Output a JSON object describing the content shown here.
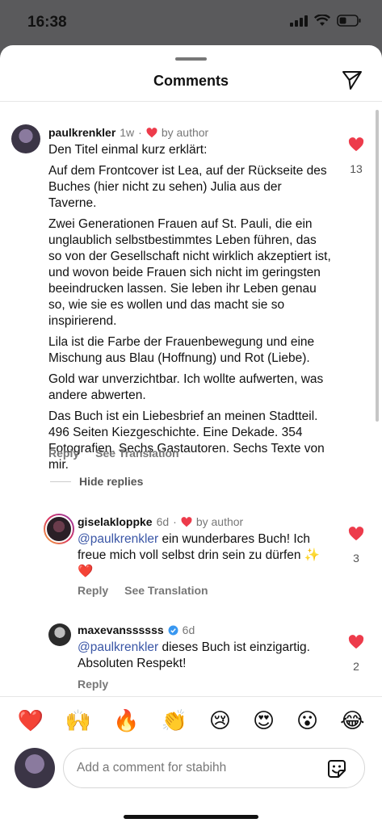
{
  "status_bar": {
    "time": "16:38",
    "icons": [
      "signal-icon",
      "wifi-icon",
      "battery-icon"
    ]
  },
  "header": {
    "title": "Comments",
    "share_icon": "send-icon"
  },
  "comments": [
    {
      "username": "paulkrenkler",
      "time": "1w",
      "liked_by_author": true,
      "by_author_label": "by author",
      "paragraphs": [
        "Den Titel einmal kurz erklärt:",
        "Auf dem Frontcover ist Lea, auf der Rückseite des Buches (hier nicht zu sehen) Julia aus der Taverne.",
        "Zwei Generationen Frauen auf St. Pauli, die ein unglaublich selbstbestimmtes Leben führen, das so von der Gesellschaft nicht wirklich akzeptiert ist, und wovon beide Frauen sich nicht im geringsten beeindrucken lassen. Sie leben ihr Leben genau so, wie sie es wollen und das macht sie so inspirierend.",
        "Lila ist die Farbe der Frauenbewegung und eine Mischung aus Blau (Hoffnung) und Rot (Liebe).",
        "Gold war unverzichtbar. Ich wollte aufwerten, was andere abwerten.",
        "Das Buch ist ein Liebesbrief an meinen Stadtteil. 496 Seiten Kiezgeschichte. Eine Dekade. 354 Fotografien. Sechs Gastautoren. Sechs Texte von mir."
      ],
      "reply_label": "Reply",
      "translation_label": "See Translation",
      "likes": "13",
      "liked": true
    },
    {
      "username": "giselakloppke",
      "time": "6d",
      "liked_by_author": true,
      "by_author_label": "by author",
      "mention": "@paulkrenkler",
      "text": " ein wunderbares Buch! Ich freue mich voll selbst drin sein zu dürfen ✨❤️",
      "reply_label": "Reply",
      "translation_label": "See Translation",
      "likes": "3",
      "liked": true
    },
    {
      "username": "maxevanssssss",
      "verified": true,
      "time": "6d",
      "mention": "@paulkrenkler",
      "text": " dieses Buch ist einzigartig. Absoluten Respekt!",
      "reply_label": "Reply",
      "likes": "2",
      "liked": true
    }
  ],
  "hide_replies_label": "Hide replies",
  "reactions": [
    "❤️",
    "🙌",
    "🔥",
    "👏",
    "😢",
    "😍",
    "😮",
    "😂"
  ],
  "composer": {
    "placeholder": "Add a comment for stabihh",
    "sticker_icon": "sticker-icon"
  },
  "colors": {
    "heart": "#ed3b4b",
    "mention": "#3a56a6",
    "muted": "#777777"
  }
}
